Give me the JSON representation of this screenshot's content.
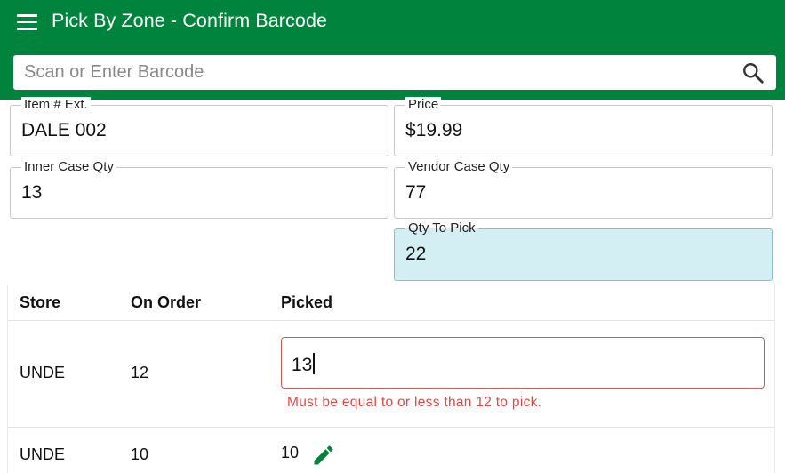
{
  "header": {
    "title": "Pick By Zone - Confirm Barcode",
    "menu_icon": "hamburger-menu-icon",
    "color": "#00843d"
  },
  "search": {
    "placeholder": "Scan or Enter Barcode",
    "value": "",
    "icon": "search-icon"
  },
  "fields": {
    "item_ext": {
      "label": "Item # Ext.",
      "value": "DALE 002"
    },
    "price": {
      "label": "Price",
      "value": "$19.99"
    },
    "inner_case_qty": {
      "label": "Inner Case Qty",
      "value": "13"
    },
    "vendor_case_qty": {
      "label": "Vendor Case Qty",
      "value": "77"
    },
    "qty_to_pick": {
      "label": "Qty To Pick",
      "value": "22",
      "highlight_color": "#d3eff3"
    }
  },
  "table": {
    "columns": [
      "Store",
      "On Order",
      "Picked"
    ],
    "rows": [
      {
        "store": "UNDE",
        "on_order": "12",
        "picked": "13",
        "editing": true,
        "error": "Must be equal to or less than 12 to pick."
      },
      {
        "store": "UNDE",
        "on_order": "10",
        "picked": "10",
        "editing": false,
        "icon": "pencil-edit-icon"
      }
    ]
  },
  "colors": {
    "error": "#e04848",
    "accent": "#00843d"
  }
}
